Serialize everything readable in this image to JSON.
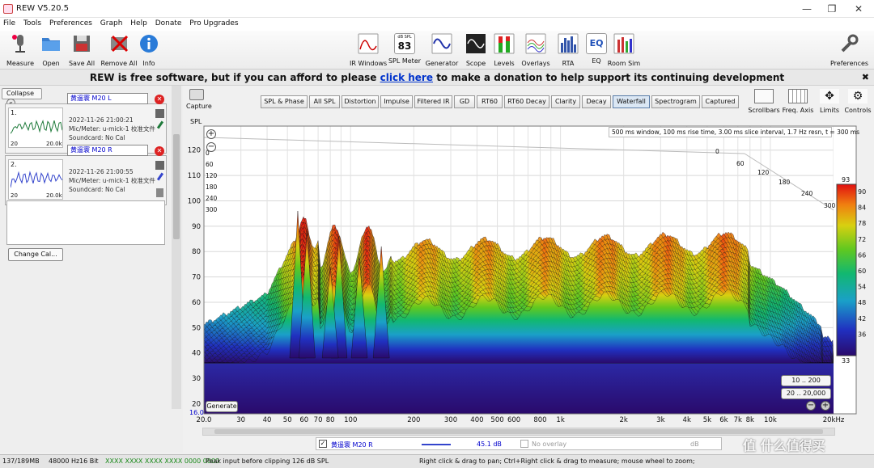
{
  "app": {
    "title": "REW V5.20.5"
  },
  "menu": [
    "File",
    "Tools",
    "Preferences",
    "Graph",
    "Help",
    "Donate",
    "Pro Upgrades"
  ],
  "toolbar_left": [
    {
      "label": "Measure",
      "icon": "microphone-icon"
    },
    {
      "label": "Open",
      "icon": "folder-icon"
    },
    {
      "label": "Save All",
      "icon": "save-icon"
    },
    {
      "label": "Remove All",
      "icon": "remove-icon"
    },
    {
      "label": "Info",
      "icon": "info-icon"
    }
  ],
  "toolbar_center": [
    {
      "label": "IR Windows",
      "icon": "ir-windows-icon"
    },
    {
      "label": "SPL Meter",
      "icon": "spl-meter-icon",
      "value": "83",
      "unit": "dB SPL"
    },
    {
      "label": "Generator",
      "icon": "generator-icon"
    },
    {
      "label": "Scope",
      "icon": "scope-icon"
    },
    {
      "label": "Levels",
      "icon": "levels-icon"
    },
    {
      "label": "Overlays",
      "icon": "overlays-icon"
    },
    {
      "label": "RTA",
      "icon": "rta-icon"
    },
    {
      "label": "EQ",
      "icon": "eq-icon"
    },
    {
      "label": "Room Sim",
      "icon": "room-sim-icon"
    }
  ],
  "toolbar_right": {
    "label": "Preferences",
    "icon": "wrench-icon"
  },
  "banner": {
    "pre": "REW is free software, but if you can afford to please",
    "link": "click here",
    "post": "to make a donation to help support its continuing development",
    "close": "✖"
  },
  "left_panel": {
    "collapse_label": "Collapse",
    "measurements": [
      {
        "index": "1.",
        "name": "黄遥寰 M20 L",
        "date": "2022-11-26 21:00:21",
        "mic": "Mic/Meter: u-mick-1 校准文件",
        "soundcard": "Soundcard: No Cal",
        "thumb_left": "20",
        "thumb_right": "20.0k",
        "color": "#1e7a3a"
      },
      {
        "index": "2.",
        "name": "黄遥寰 M20 R",
        "date": "2022-11-26 21:00:55",
        "mic": "Mic/Meter: u-mick-1 校准文件",
        "soundcard": "Soundcard: No Cal",
        "thumb_left": "20",
        "thumb_right": "20.0k",
        "color": "#3344cc"
      }
    ],
    "change_cal": "Change Cal..."
  },
  "graph_tabs": [
    "SPL & Phase",
    "All SPL",
    "Distortion",
    "Impulse",
    "Filtered IR",
    "GD",
    "RT60",
    "RT60 Decay",
    "Clarity",
    "Decay",
    "Waterfall",
    "Spectrogram",
    "Captured"
  ],
  "active_tab": "Waterfall",
  "capture_label": "Capture",
  "right_tools": [
    "Scrollbars",
    "Freq. Axis",
    "Limits",
    "Controls"
  ],
  "chart_data": {
    "type": "area",
    "ylabel": "SPL",
    "x_ticks": [
      "20.0",
      "30",
      "40",
      "50",
      "60",
      "70",
      "80",
      "100",
      "200",
      "300",
      "400",
      "500",
      "600",
      "800",
      "1k",
      "2k",
      "3k",
      "4k",
      "5k",
      "6k",
      "7k",
      "8k",
      "10k",
      "20kHz"
    ],
    "y_ticks": [
      "120",
      "110",
      "100",
      "90",
      "80",
      "70",
      "60",
      "50",
      "40",
      "30",
      "20"
    ],
    "ylim": [
      16,
      125
    ],
    "ylim_bottom_label": "16.0",
    "time_ticks_left": [
      "0",
      "60",
      "120",
      "180",
      "240",
      "300"
    ],
    "time_ticks_right": [
      "0",
      "60",
      "120",
      "180",
      "240",
      "300"
    ],
    "info": "500 ms window, 100 ms rise time, 3.00 ms slice interval, 1.7 Hz resn, t = 300 ms",
    "colorbar": {
      "max": "93",
      "min": "33",
      "ticks": [
        "90",
        "84",
        "78",
        "72",
        "66",
        "60",
        "54",
        "48",
        "42",
        "36"
      ]
    },
    "buttons": {
      "generate": "Generate",
      "range1": "10 .. 200",
      "range2": "20 .. 20,000"
    }
  },
  "overlay": {
    "name": "黄遥寰 M20 R",
    "value": "45.1 dB",
    "no_overlay": "No overlay",
    "unit": "dB"
  },
  "status": {
    "memory": "137/189MB",
    "rate": "48000 Hz",
    "bits": "16 Bit",
    "meter": "XXXX XXXX  XXXX XXXX  0000 0000",
    "peak": "Peak input before clipping 126 dB SPL",
    "hint": "Right click & drag to pan; Ctrl+Right click & drag to measure; mouse wheel to zoom;"
  },
  "watermark": "值 什么值得买"
}
